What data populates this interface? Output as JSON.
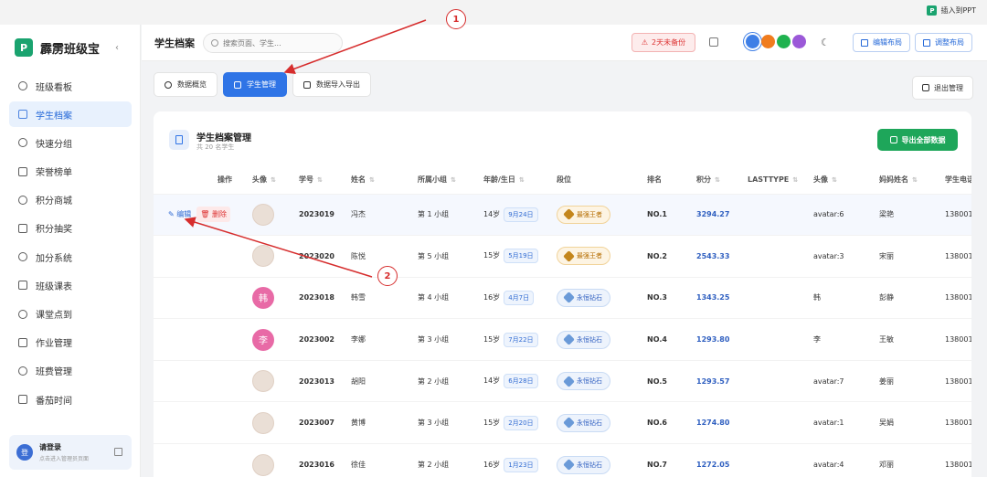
{
  "topbar": {
    "ppt_label": "插入到PPT"
  },
  "sidebar": {
    "brand": "霹雳班级宝",
    "items": [
      {
        "label": "班级看板"
      },
      {
        "label": "学生档案",
        "active": true
      },
      {
        "label": "快速分组"
      },
      {
        "label": "荣誉榜单"
      },
      {
        "label": "积分商城"
      },
      {
        "label": "积分抽奖"
      },
      {
        "label": "加分系统"
      },
      {
        "label": "班级课表"
      },
      {
        "label": "课堂点到"
      },
      {
        "label": "作业管理"
      },
      {
        "label": "班费管理"
      },
      {
        "label": "番茄时间"
      }
    ],
    "login": {
      "avatar": "登",
      "title": "请登录",
      "subtitle": "点击进入管理员页面"
    }
  },
  "header": {
    "title": "学生档案",
    "search_placeholder": "搜索页面、学生...",
    "backup_warning": "2天未备份",
    "edit_layout": "编辑布局",
    "adjust_layout": "调整布局",
    "theme_colors": [
      "#3f7fe6",
      "#f07c1e",
      "#1fb24f",
      "#9b59d8"
    ]
  },
  "tabs": [
    {
      "label": "数据概览"
    },
    {
      "label": "学生管理",
      "active": true
    },
    {
      "label": "数据导入导出"
    }
  ],
  "exit_label": "退出管理",
  "panel": {
    "title": "学生档案管理",
    "subtitle": "共 20 名学生",
    "export_label": "导出全部数据"
  },
  "table": {
    "columns": [
      "操作",
      "头像",
      "学号",
      "姓名",
      "所属小组",
      "年龄/生日",
      "段位",
      "排名",
      "积分",
      "LASTTYPE",
      "头像",
      "妈妈姓名",
      "学生电话"
    ],
    "edit_label": "编辑",
    "delete_label": "删除",
    "rows": [
      {
        "avatar": "",
        "id": "2023019",
        "name": "冯杰",
        "group": "第 1 小组",
        "age": "14岁",
        "birthday": "9月24日",
        "rank_title": "最强王者",
        "rank_type": "king",
        "rank": "NO.1",
        "score": "3294.27",
        "lasttype": "",
        "avatar2": "avatar:6",
        "mother": "梁艳",
        "phone": "138001"
      },
      {
        "avatar": "",
        "id": "2023020",
        "name": "陈悦",
        "group": "第 5 小组",
        "age": "15岁",
        "birthday": "5月19日",
        "rank_title": "最强王者",
        "rank_type": "king",
        "rank": "NO.2",
        "score": "2543.33",
        "lasttype": "",
        "avatar2": "avatar:3",
        "mother": "宋丽",
        "phone": "138001"
      },
      {
        "avatar": "韩",
        "id": "2023018",
        "name": "韩雪",
        "group": "第 4 小组",
        "age": "16岁",
        "birthday": "4月7日",
        "rank_title": "永恒钻石",
        "rank_type": "dia",
        "rank": "NO.3",
        "score": "1343.25",
        "lasttype": "",
        "avatar2": "韩",
        "mother": "彭静",
        "phone": "138001"
      },
      {
        "avatar": "李",
        "id": "2023002",
        "name": "李娜",
        "group": "第 3 小组",
        "age": "15岁",
        "birthday": "7月22日",
        "rank_title": "永恒钻石",
        "rank_type": "dia",
        "rank": "NO.4",
        "score": "1293.80",
        "lasttype": "",
        "avatar2": "李",
        "mother": "王敏",
        "phone": "138001"
      },
      {
        "avatar": "",
        "id": "2023013",
        "name": "胡阳",
        "group": "第 2 小组",
        "age": "14岁",
        "birthday": "6月28日",
        "rank_title": "永恒钻石",
        "rank_type": "dia",
        "rank": "NO.5",
        "score": "1293.57",
        "lasttype": "",
        "avatar2": "avatar:7",
        "mother": "姜丽",
        "phone": "138001"
      },
      {
        "avatar": "",
        "id": "2023007",
        "name": "黄博",
        "group": "第 3 小组",
        "age": "15岁",
        "birthday": "2月20日",
        "rank_title": "永恒钻石",
        "rank_type": "dia",
        "rank": "NO.6",
        "score": "1274.80",
        "lasttype": "",
        "avatar2": "avatar:1",
        "mother": "吴娟",
        "phone": "138001"
      },
      {
        "avatar": "",
        "id": "2023016",
        "name": "徐佳",
        "group": "第 2 小组",
        "age": "16岁",
        "birthday": "1月23日",
        "rank_title": "永恒钻石",
        "rank_type": "dia",
        "rank": "NO.7",
        "score": "1272.05",
        "lasttype": "",
        "avatar2": "avatar:4",
        "mother": "邓丽",
        "phone": "138001"
      }
    ]
  },
  "annotations": {
    "callout_1": "1",
    "callout_2": "2"
  }
}
